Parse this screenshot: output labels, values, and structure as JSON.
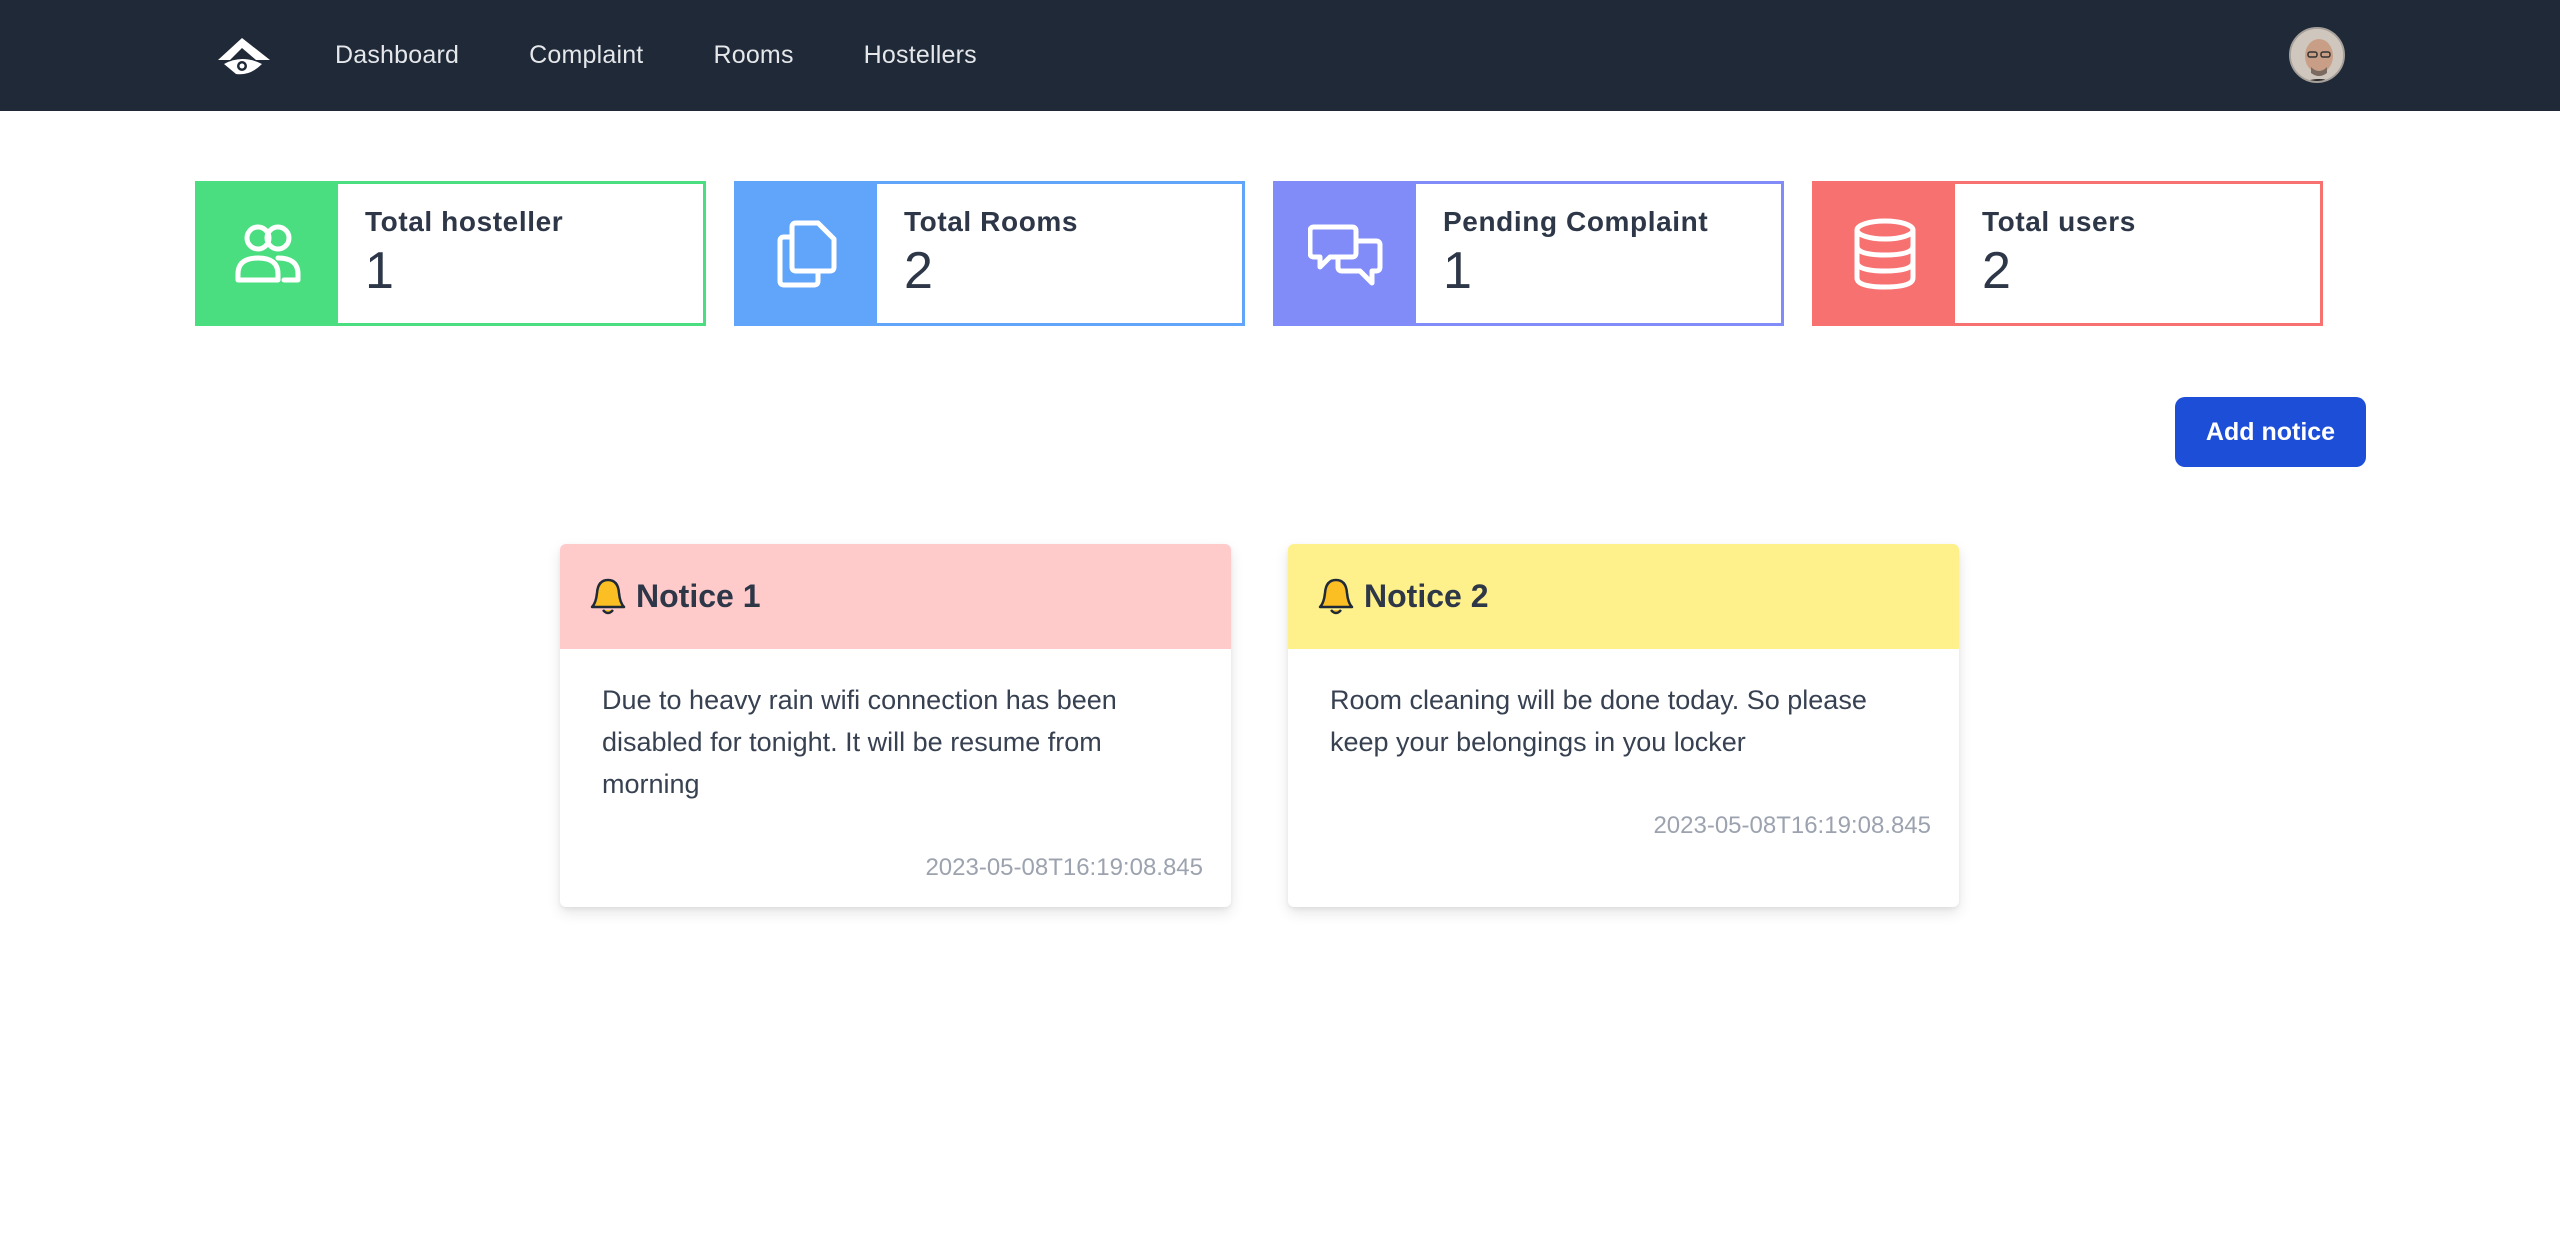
{
  "nav": {
    "links": [
      "Dashboard",
      "Complaint",
      "Rooms",
      "Hostellers"
    ]
  },
  "stats": [
    {
      "label": "Total hosteller",
      "value": "1",
      "color": "#4ade80",
      "icon": "users-icon"
    },
    {
      "label": "Total Rooms",
      "value": "2",
      "color": "#60a5fa",
      "icon": "documents-icon"
    },
    {
      "label": "Pending Complaint",
      "value": "1",
      "color": "#818cf8",
      "icon": "chat-bubbles-icon"
    },
    {
      "label": "Total users",
      "value": "2",
      "color": "#f87171",
      "icon": "database-icon"
    }
  ],
  "actions": {
    "add_notice": "Add notice"
  },
  "notices": [
    {
      "title": "Notice 1",
      "body": "Due to heavy rain wifi connection has been disabled for tonight. It will be resume from morning",
      "date": "2023-05-08T16:19:08.845",
      "color": "#fecaca"
    },
    {
      "title": "Notice 2",
      "body": "Room cleaning will be done today. So please keep your belongings in you locker",
      "date": "2023-05-08T16:19:08.845",
      "color": "#fef08a"
    }
  ]
}
